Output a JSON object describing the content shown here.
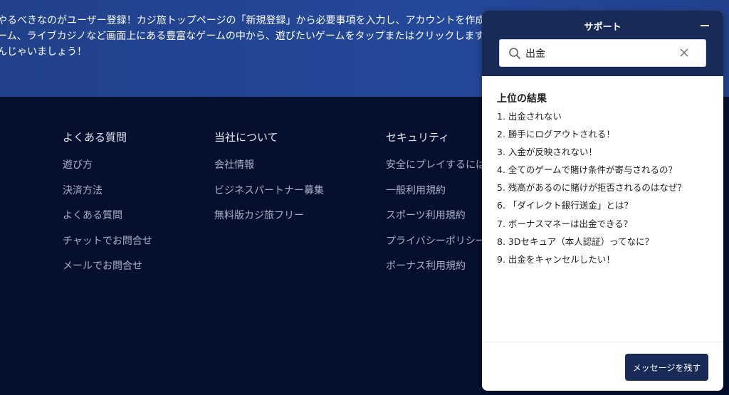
{
  "hero": {
    "text": "やるべきなのがユーザー登録！カジ旅トップページの「新規登録」から必要事項を入力し、アカウントを作成し\nーム、ライブカジノなど画面上にある豊富なゲームの中から、遊びたいゲームをタップまたはクリックします。\nんじゃいましょう！"
  },
  "footer": {
    "columns": [
      {
        "title": "よくある質問",
        "links": [
          "遊び方",
          "決済方法",
          "よくある質問",
          "チャットでお問合せ",
          "メールでお問合せ"
        ]
      },
      {
        "title": "当社について",
        "links": [
          "会社情報",
          "ビジネスパートナー募集",
          "無料版カジ旅フリー"
        ]
      },
      {
        "title": "セキュリティ",
        "links": [
          "安全にプレイするには",
          "一般利用規約",
          "スポーツ利用規約",
          "プライバシーポリシー",
          "ボーナス利用規約"
        ]
      }
    ]
  },
  "widget": {
    "title": "サポート",
    "search": {
      "value": "出金",
      "placeholder": ""
    },
    "results_title": "上位の結果",
    "results": [
      "1.  出金されない",
      "2.  勝手にログアウトされる！",
      "3.  入金が反映されない！",
      "4.  全てのゲームで賭け条件が寄与されるの？",
      "5.  残高があるのに賭けが拒否されるのはなぜ？",
      "6.  「ダイレクト銀行送金」とは？",
      "7.  ボーナスマネーは出金できる？",
      "8.  3Dセキュア（本人認証）ってなに？",
      "9.  出金をキャンセルしたい！"
    ],
    "leave_message_label": "メッセージを残す"
  },
  "colors": {
    "hero_bg": "#23469a",
    "footer_bg": "#05102f",
    "widget_header": "#1a2a57",
    "button": "#1a2a57"
  },
  "icons": {
    "search": "search-icon",
    "clear": "close-icon",
    "minimize": "minimize-icon"
  }
}
